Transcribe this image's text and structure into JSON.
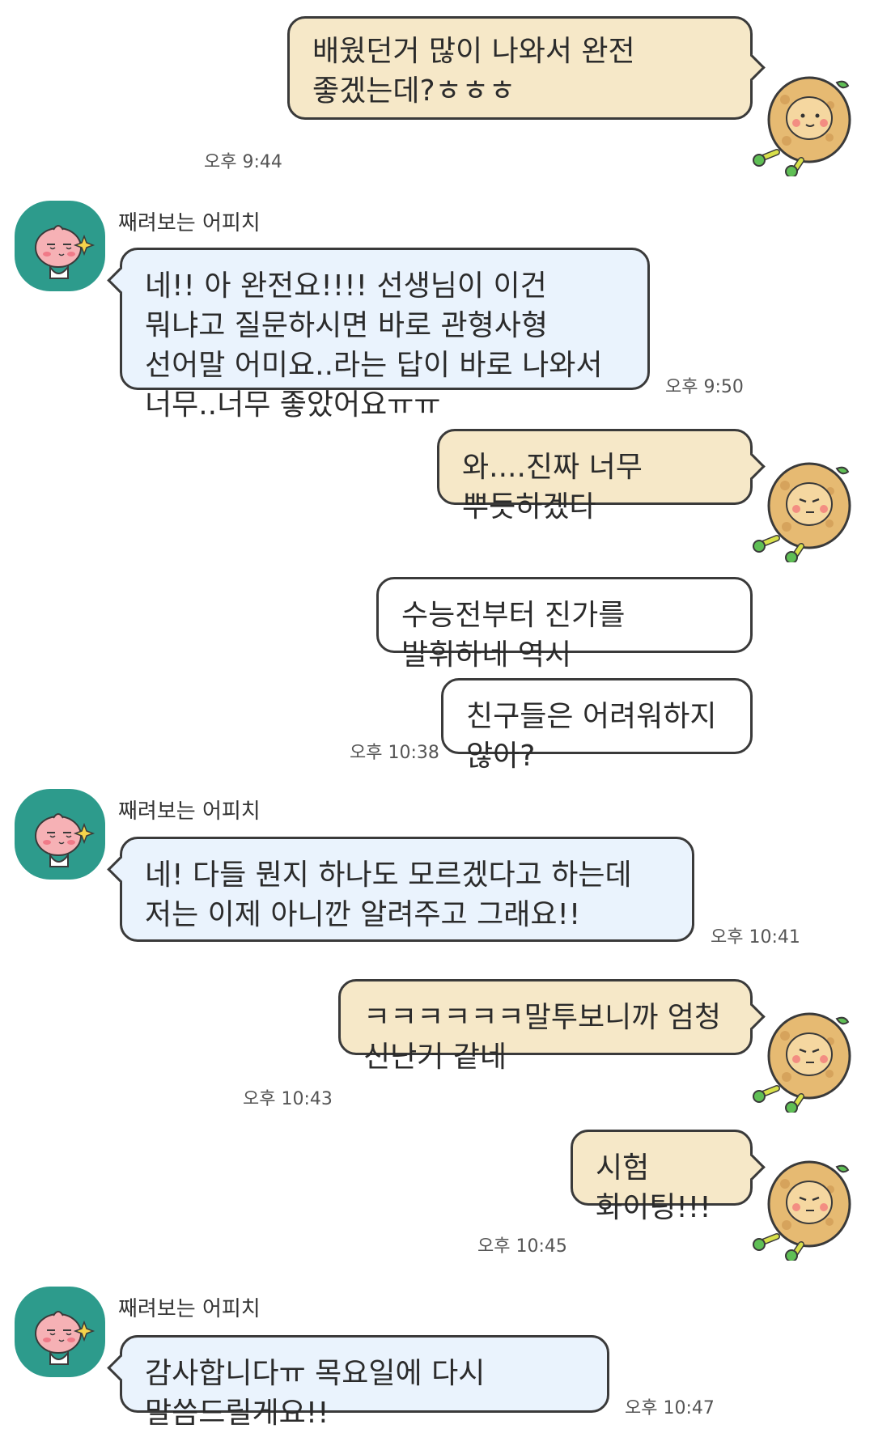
{
  "chat": {
    "sender_name": "째려보는 어피치",
    "messages": [
      {
        "text": "배웠던거 많이 나와서 완전 좋겠는데?ㅎㅎㅎ",
        "time": "오후 9:44"
      },
      {
        "text": "네!! 아 완전요!!!! 선생님이 이건 뭐냐고 질문하시면 바로 관형사형 선어말 어미요..라는 답이 바로 나와서 너무..너무 좋았어요ㅠㅠ",
        "time": "오후 9:50"
      },
      {
        "text": "와....진짜 너무 뿌듯하겠다"
      },
      {
        "text": "수능전부터 진가를 발휘하네 역시"
      },
      {
        "text": "친구들은 어려워하지 않아?",
        "time": "오후 10:38"
      },
      {
        "text": "네! 다들 뭔지 하나도 모르겠다고 하는데 저는 이제 아니깐 알려주고 그래요!!",
        "time": "오후 10:41"
      },
      {
        "text": "ㅋㅋㅋㅋㅋㅋ말투보니까 엄청 신난거 같네",
        "time": "오후 10:43"
      },
      {
        "text": "시험 화이팅!!!",
        "time": "오후 10:45"
      },
      {
        "text": "감사합니다ㅠ 목요일에 다시 말씀드릴게요!!",
        "time": "오후 10:47"
      }
    ]
  },
  "icons": {
    "my_avatar": "orange-character-sticker",
    "their_avatar": "peach-character-avatar"
  },
  "colors": {
    "my_bubble": "#f6e8c8",
    "my_bubble_alt": "#ffffff",
    "their_bubble": "#eaf3fd",
    "avatar_bg": "#2d9b8c",
    "border": "#3a3a3a"
  }
}
